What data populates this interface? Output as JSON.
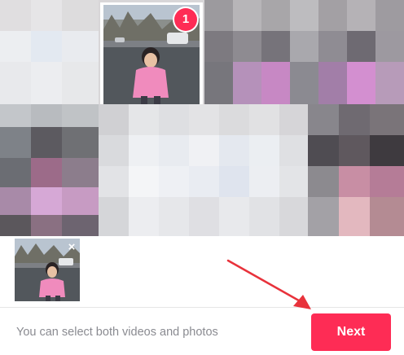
{
  "gallery": {
    "selected_badge": "1"
  },
  "selection_strip": {
    "remove_label": "×"
  },
  "footer": {
    "hint": "You can select both videos and photos",
    "next_label": "Next"
  },
  "colors": {
    "accent": "#fe2c55",
    "hint_text": "#8a8b91"
  }
}
